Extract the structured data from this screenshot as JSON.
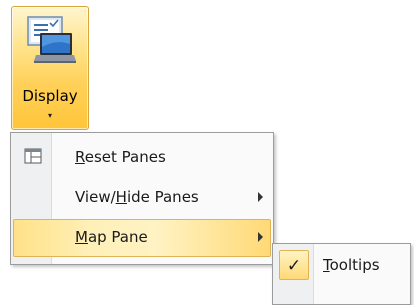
{
  "ribbon": {
    "display_label": "Display",
    "dropdown_arrow": "▾",
    "display_icon": "monitor-icon"
  },
  "menu": {
    "items": [
      {
        "label": "Reset Panes",
        "has_submenu": false,
        "icon": "reset-panes-icon"
      },
      {
        "label": "View/Hide Panes",
        "has_submenu": true
      },
      {
        "label": "Map Pane",
        "has_submenu": true,
        "highlighted": true
      }
    ]
  },
  "submenu": {
    "items": [
      {
        "label": "Tooltips",
        "checked": true,
        "check_glyph": "✓"
      }
    ]
  },
  "colors": {
    "highlight": "#ffe188",
    "highlight_border": "#e0b456",
    "menu_bg": "#fafafa",
    "gutter_bg": "#eef0f2"
  }
}
